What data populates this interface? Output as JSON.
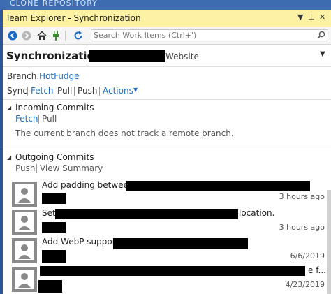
{
  "background_strip": {
    "text": "CLONE REPOSITORY"
  },
  "window": {
    "title": "Team Explorer - Synchronization",
    "title_buttons": [
      "▼",
      "⊥",
      "✕"
    ]
  },
  "toolbar": {
    "search_placeholder": "Search Work Items (Ctrl+')",
    "icons": [
      "back-icon",
      "forward-icon",
      "home-icon",
      "connect-icon",
      "refresh-icon",
      "search-icon"
    ]
  },
  "header": {
    "title": "Synchronization",
    "repo_suffix": "Website"
  },
  "branch": {
    "label": "Branch:",
    "name": "HotFudge"
  },
  "actions": {
    "sync": "Sync",
    "fetch": "Fetch",
    "pull": "Pull",
    "push": "Push",
    "more": "Actions"
  },
  "incoming": {
    "title": "Incoming Commits",
    "fetch": "Fetch",
    "pull": "Pull",
    "message": "The current branch does not track a remote branch."
  },
  "outgoing": {
    "title": "Outgoing Commits",
    "push": "Push",
    "view_summary": "View Summary",
    "commits": [
      {
        "message": "Add padding between",
        "time": "3 hours ago"
      },
      {
        "message": "Set",
        "message_end": "location.",
        "time": "3 hours ago"
      },
      {
        "message": "Add WebP support",
        "time": "6/6/2019"
      },
      {
        "message": "e f...",
        "time": "4/23/2019"
      }
    ]
  },
  "colors": {
    "title_bar": "#fdf2a3",
    "link": "#1e6fc3",
    "frame": "#2b579a"
  }
}
